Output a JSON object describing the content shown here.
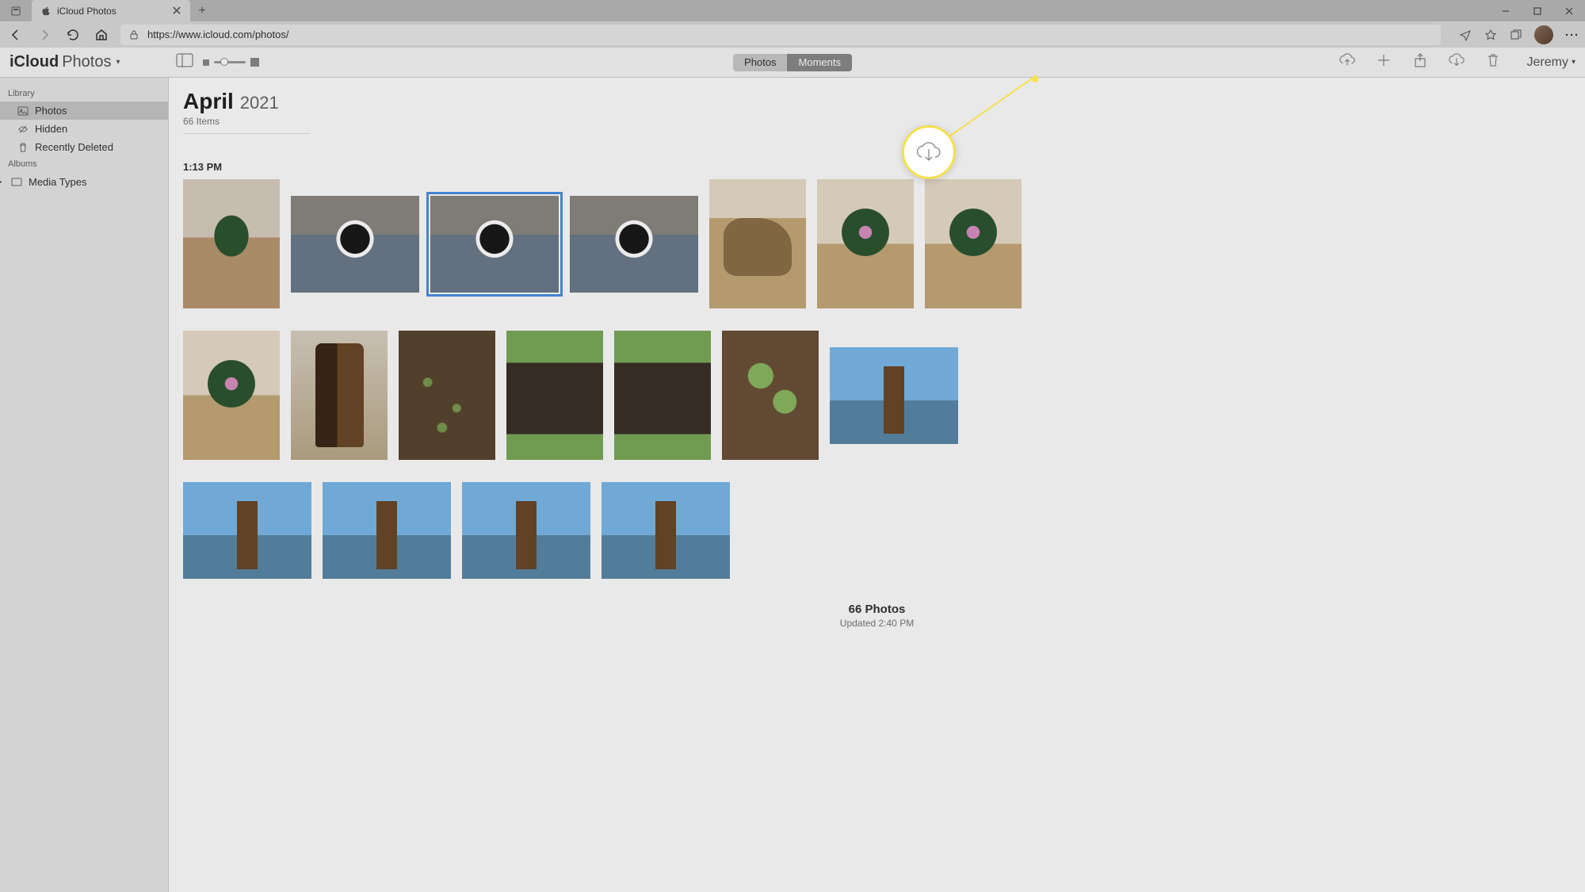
{
  "browser": {
    "tab_title": "iCloud Photos",
    "url": "https://www.icloud.com/photos/"
  },
  "app": {
    "title_bold": "iCloud",
    "title_light": "Photos"
  },
  "segmented": {
    "photos": "Photos",
    "moments": "Moments"
  },
  "user_name": "Jeremy",
  "sidebar": {
    "library_header": "Library",
    "albums_header": "Albums",
    "items": {
      "photos": "Photos",
      "hidden": "Hidden",
      "recently_deleted": "Recently Deleted",
      "media_types": "Media Types"
    }
  },
  "content": {
    "month": "April",
    "year": "2021",
    "item_count": "66 Items",
    "time_label": "1:13 PM",
    "footer_count": "66 Photos",
    "footer_updated": "Updated 2:40 PM"
  }
}
